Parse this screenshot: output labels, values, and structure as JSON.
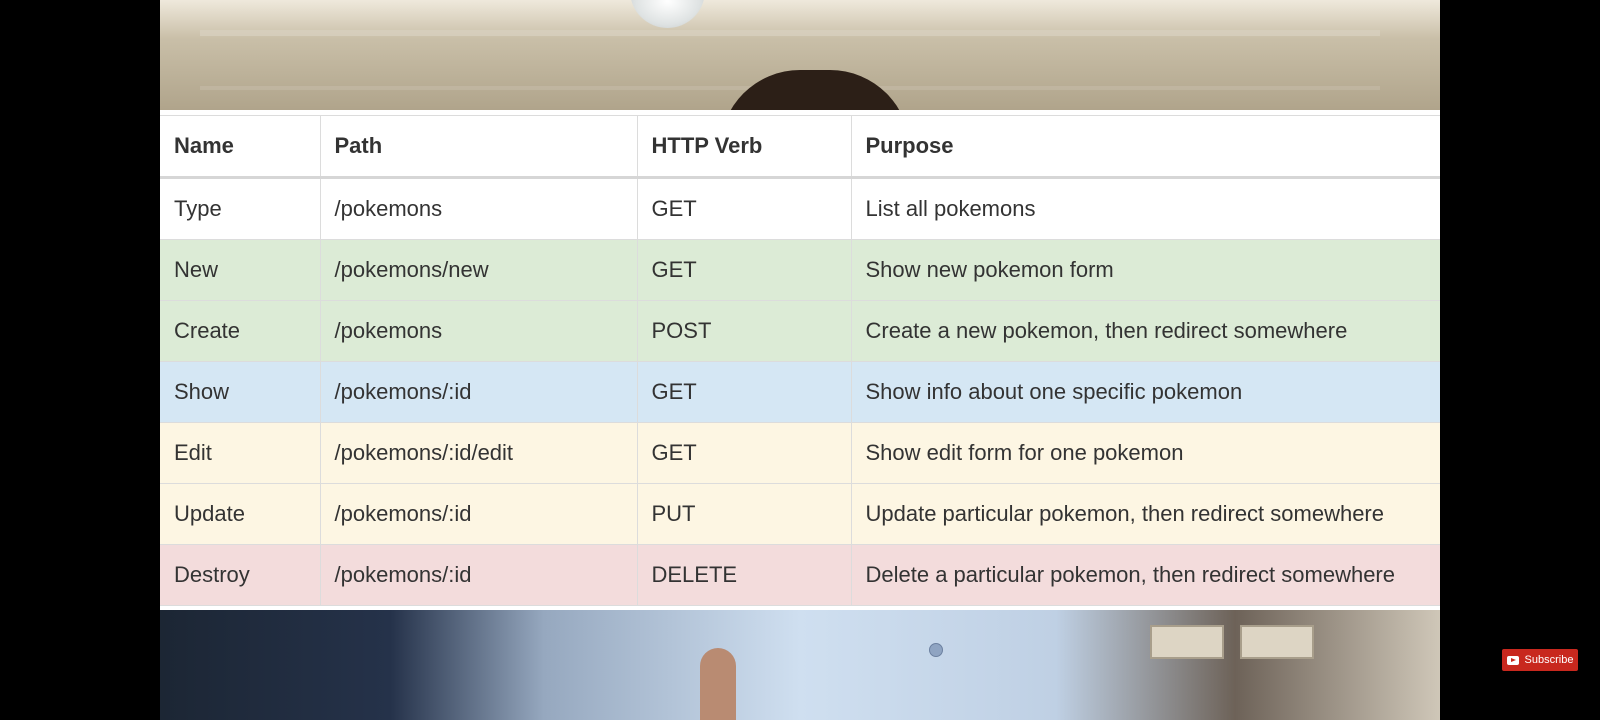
{
  "table": {
    "headers": {
      "name": "Name",
      "path": "Path",
      "verb": "HTTP Verb",
      "purpose": "Purpose"
    },
    "rows": [
      {
        "name": "Type",
        "path": "/pokemons",
        "verb": "GET",
        "purpose": "List all pokemons",
        "color": "#ffffff"
      },
      {
        "name": "New",
        "path": "/pokemons/new",
        "verb": "GET",
        "purpose": "Show new pokemon form",
        "color": "#dcebd6"
      },
      {
        "name": "Create",
        "path": "/pokemons",
        "verb": "POST",
        "purpose": "Create a new pokemon, then redirect somewhere",
        "color": "#dcebd6"
      },
      {
        "name": "Show",
        "path": "/pokemons/:id",
        "verb": "GET",
        "purpose": "Show info about one specific pokemon",
        "color": "#d5e7f4"
      },
      {
        "name": "Edit",
        "path": "/pokemons/:id/edit",
        "verb": "GET",
        "purpose": "Show edit form for one pokemon",
        "color": "#fdf6e3"
      },
      {
        "name": "Update",
        "path": "/pokemons/:id",
        "verb": "PUT",
        "purpose": "Update particular pokemon, then redirect somewhere",
        "color": "#fdf6e3"
      },
      {
        "name": "Destroy",
        "path": "/pokemons/:id",
        "verb": "DELETE",
        "purpose": "Delete a particular pokemon, then redirect somewhere",
        "color": "#f3dcdc"
      }
    ]
  },
  "overlay": {
    "subscribe_label": "Subscribe",
    "subscribe_icon": "youtube-icon",
    "subscribe_color": "#c8281e"
  }
}
